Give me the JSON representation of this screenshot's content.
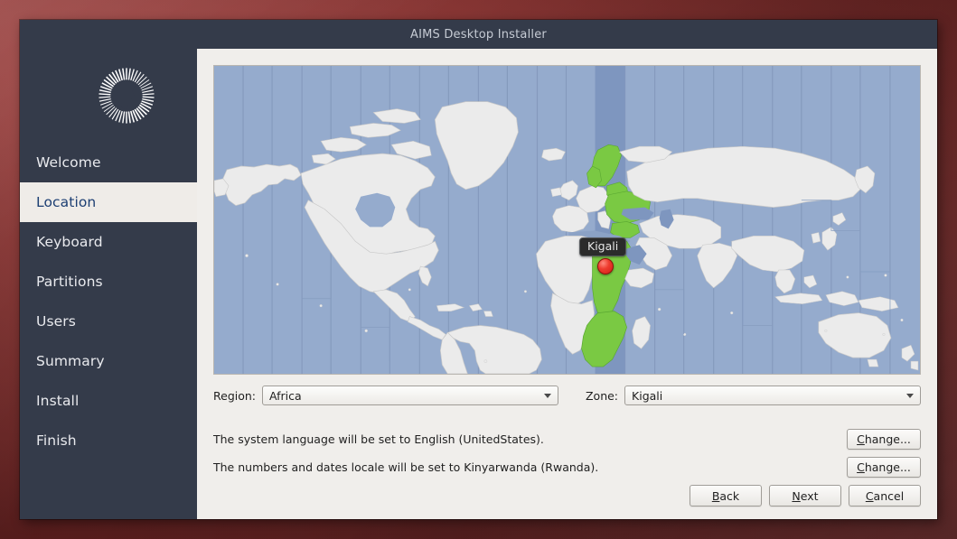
{
  "window": {
    "title": "AIMS Desktop Installer"
  },
  "sidebar": {
    "logo_icon": "aims-radial-logo-icon",
    "items": [
      {
        "label": "Welcome",
        "active": false
      },
      {
        "label": "Location",
        "active": true
      },
      {
        "label": "Keyboard",
        "active": false
      },
      {
        "label": "Partitions",
        "active": false
      },
      {
        "label": "Users",
        "active": false
      },
      {
        "label": "Summary",
        "active": false
      },
      {
        "label": "Install",
        "active": false
      },
      {
        "label": "Finish",
        "active": false
      }
    ]
  },
  "map": {
    "marker_icon": "location-pin-icon",
    "tooltip_label": "Kigali",
    "ocean_color": "#95abcd",
    "land_color": "#ebebeb",
    "highlight_color": "#7ac943",
    "timezone_band_color": "#7e96bf",
    "marker_color": "#ee3b2e"
  },
  "selectors": {
    "region_label": "Region:",
    "region_value": "Africa",
    "zone_label": "Zone:",
    "zone_value": "Kigali",
    "dropdown_icon": "chevron-down-icon"
  },
  "info": {
    "language_text": "The system language will be set to English (UnitedStates).",
    "language_change_mnemonic": "C",
    "language_change_rest": "hange...",
    "locale_text": "The numbers and dates locale will be set to Kinyarwanda (Rwanda).",
    "locale_change_mnemonic": "C",
    "locale_change_rest": "hange..."
  },
  "footer": {
    "back_mnemonic": "B",
    "back_rest": "ack",
    "next_mnemonic": "N",
    "next_rest": "ext",
    "cancel_mnemonic": "C",
    "cancel_rest": "ancel"
  }
}
